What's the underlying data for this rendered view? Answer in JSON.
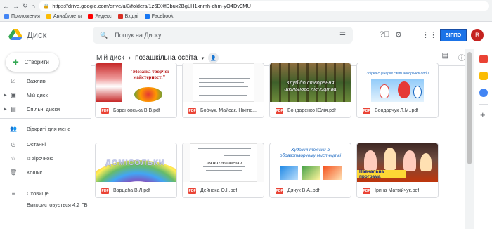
{
  "browser": {
    "url": "https://drive.google.com/drive/u/3/folders/1z6DXfDbux2BgLH1xnmh-chm-yO4Dv9MU",
    "bookmarks": [
      "Приложения",
      "Авиабилеты",
      "Яндекс",
      "Вхідні",
      "Facebook"
    ]
  },
  "app": {
    "name": "Диск"
  },
  "search": {
    "placeholder": "Пошук на Диску"
  },
  "account": {
    "org_label": "ВІППО",
    "avatar_letter": "В"
  },
  "sidebar": {
    "create_label": "Створити",
    "items": [
      {
        "label": "Важливі",
        "icon": "checkbox-icon"
      },
      {
        "label": "Мій диск",
        "icon": "drive-icon"
      },
      {
        "label": "Спільні диски",
        "icon": "shared-drives-icon"
      },
      {
        "label": "Відкриті для мене",
        "icon": "people-icon"
      },
      {
        "label": "Останні",
        "icon": "clock-icon"
      },
      {
        "label": "Із зірочкою",
        "icon": "star-icon"
      },
      {
        "label": "Кошик",
        "icon": "trash-icon"
      },
      {
        "label": "Сховище",
        "icon": "storage-icon"
      }
    ],
    "storage_text": "Використовується 4,2 ГБ"
  },
  "breadcrumb": {
    "root": "Мій диск",
    "current": "позашкільна освіта"
  },
  "files": [
    {
      "name": "Барановська В В.pdf",
      "thumb_title": "\"Мозаїка творчої майстерності\""
    },
    {
      "name": "Бобчук, Майсак, Нікітю...",
      "thumb_title": ""
    },
    {
      "name": "Бондаренко Юлія.pdf",
      "thumb_title": "Клуб до створення шкільного лісництва"
    },
    {
      "name": "Бондарчук Л.М..pdf",
      "thumb_title": "Збірка сценаріїв свят новорічної доби"
    },
    {
      "name": "Варцаба В Л.pdf",
      "thumb_title": "ДОМІСОЛЬКИ"
    },
    {
      "name": "Дейнека О.І..pdf",
      "thumb_title": "ПАРТИТУРА СПІВОЧОГО"
    },
    {
      "name": "Дячук В.А..pdf",
      "thumb_title": "Художні техніки в образотворчому мистецтві"
    },
    {
      "name": "Ірина Матвійчук.pdf",
      "thumb_title": "Навчальна програма"
    }
  ],
  "colors": {
    "accent": "#1a73e8",
    "pdf": "#ea4335"
  }
}
